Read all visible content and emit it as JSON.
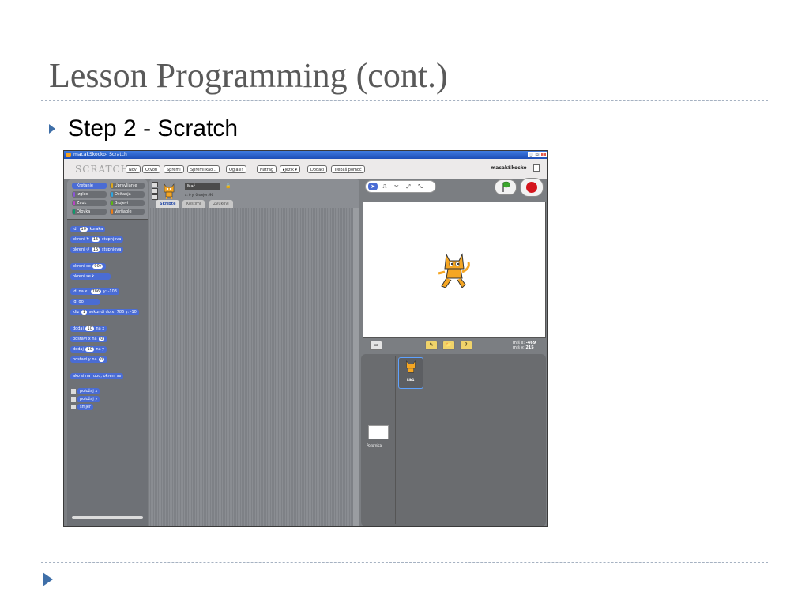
{
  "slide": {
    "title": "Lesson Programming (cont.)",
    "bullet": "Step 2 - Scratch"
  },
  "window": {
    "title": "macakSkocko- Scratch",
    "controls": [
      "_",
      "▫",
      "x"
    ],
    "logo": "SCRATCH",
    "menu": [
      "Novi",
      "Otvori",
      "Spremi",
      "Spremi kao...",
      "Oglasi!",
      "Natrag",
      "▸Jezik ▾",
      "Dodaci",
      "Trebaš pomoć"
    ],
    "project_name": "macakSkocko"
  },
  "categories": [
    {
      "label": "Kretanje",
      "color": "#4a6cd4",
      "active": true
    },
    {
      "label": "Upravljanje",
      "color": "#e1a91a"
    },
    {
      "label": "Izgled",
      "color": "#8a55d7"
    },
    {
      "label": "Očitanja",
      "color": "#2ca5e2"
    },
    {
      "label": "Zvuk",
      "color": "#bb42c3"
    },
    {
      "label": "Brojevi",
      "color": "#5cb712"
    },
    {
      "label": "Olovka",
      "color": "#0e9a6c"
    },
    {
      "label": "Varijable",
      "color": "#ee7d16"
    }
  ],
  "blocks": [
    {
      "pre": "idi",
      "num": "10",
      "post": "koraka"
    },
    {
      "pre": "okreni ↻",
      "num": "15",
      "post": "stupnjeva"
    },
    {
      "pre": "okreni ↺",
      "num": "15",
      "post": "stupnjeva"
    },
    {
      "pre": "okreni se",
      "num": "90▾",
      "post": ""
    },
    {
      "pre": "okreni se k",
      "num": "",
      "post": ""
    },
    {
      "pre": "idi na x:",
      "num": "786",
      "post": "y: -103"
    },
    {
      "pre": "idi do",
      "num": "",
      "post": ""
    },
    {
      "pre": "kliz",
      "num": "1",
      "post": "sekundi do x: 786 y: -10"
    },
    {
      "pre": "dodaj",
      "num": "10",
      "post": "na x"
    },
    {
      "pre": "postavi x na",
      "num": "0",
      "post": ""
    },
    {
      "pre": "dodaj",
      "num": "10",
      "post": "na y"
    },
    {
      "pre": "postavi y na",
      "num": "0",
      "post": ""
    },
    {
      "pre": "ako si na rubu, okreni se",
      "num": "",
      "post": ""
    }
  ],
  "reporters": [
    "položaj x",
    "položaj y",
    "smjer"
  ],
  "sprite": {
    "name": "Mač",
    "coords": "x: 0   y: 0   smjer: 90",
    "tabs": [
      "Skripte",
      "Kostimi",
      "Zvukovi"
    ]
  },
  "stage": {
    "mouse_x_label": "miš x:",
    "mouse_x": "-469",
    "mouse_y_label": "miš y:",
    "mouse_y": "215",
    "background_label": "Pozornica",
    "sprite_tile_label": "Lik1"
  }
}
